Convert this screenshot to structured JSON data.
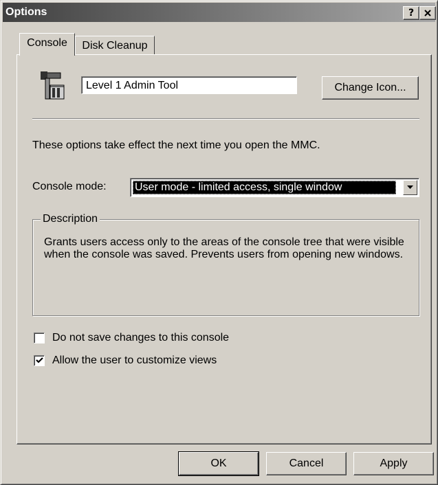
{
  "window": {
    "title": "Options",
    "help_label": "?",
    "close_label": "X"
  },
  "tabs": [
    {
      "label": "Console",
      "active": true
    },
    {
      "label": "Disk Cleanup",
      "active": false
    }
  ],
  "console": {
    "icon": "mmc-console-icon",
    "name_value": "Level 1 Admin Tool",
    "change_icon_label": "Change Icon...",
    "info_text": "These options take effect the next time you open the MMC.",
    "mode_label": "Console mode:",
    "mode_value": "User mode - limited access, single window",
    "description_title": "Description",
    "description_text": "Grants users access only to the areas of the console tree that were visible when the console was saved. Prevents users from opening new windows.",
    "options": [
      {
        "label": "Do not save changes to this console",
        "checked": false
      },
      {
        "label": "Allow the user to customize views",
        "checked": true
      }
    ]
  },
  "footer": {
    "ok_label": "OK",
    "cancel_label": "Cancel",
    "apply_label": "Apply"
  }
}
